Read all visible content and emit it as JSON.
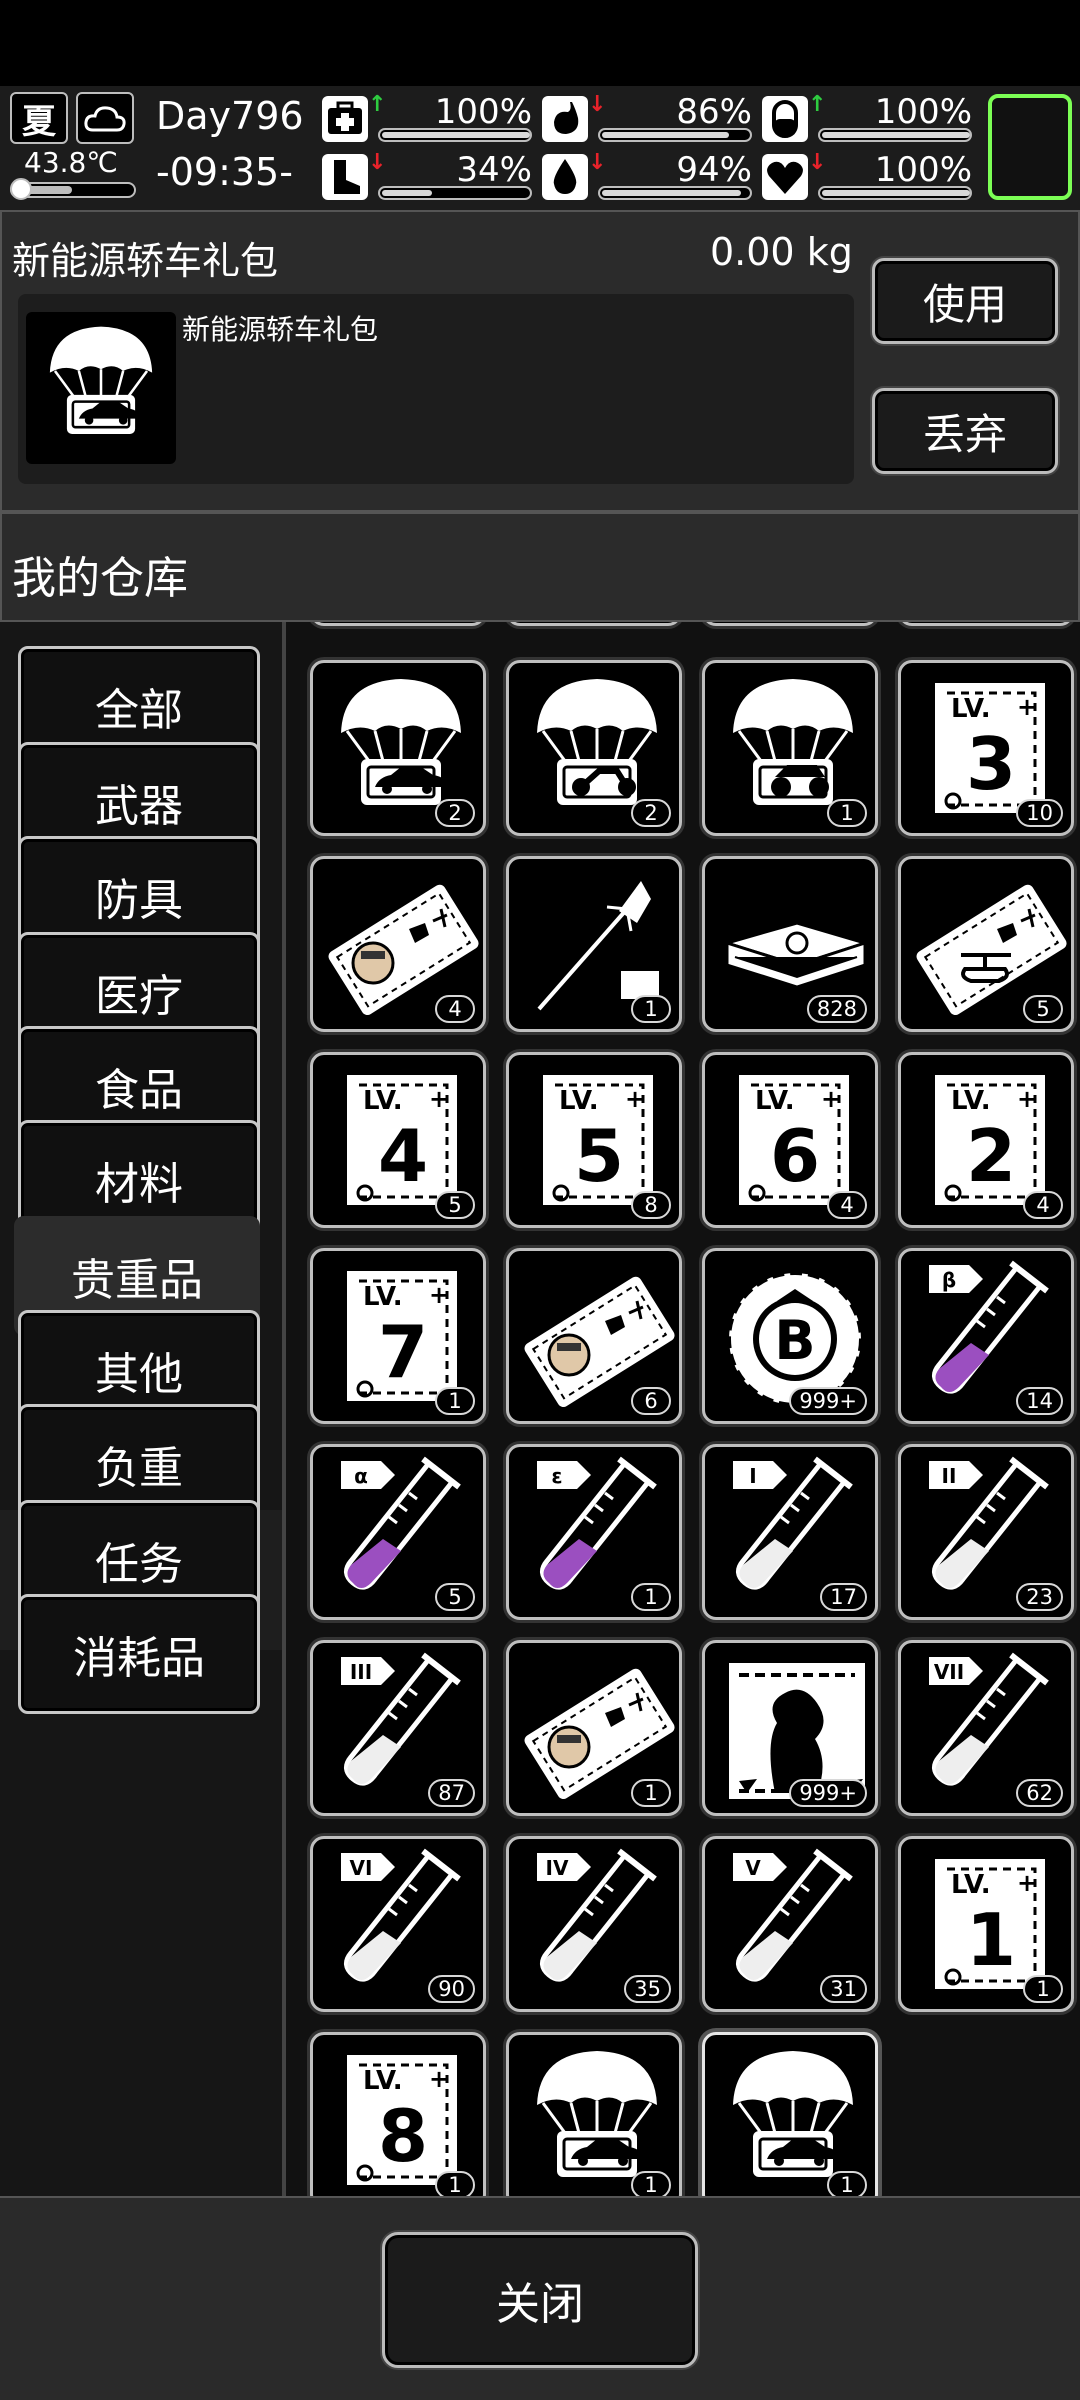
{
  "hud": {
    "season": "夏",
    "temperature": "43.8℃",
    "day": "Day796",
    "time": "-09:35-",
    "stats": [
      {
        "name": "health",
        "icon": "first-aid-icon",
        "trend": "up",
        "value": "100%",
        "level": 1.0
      },
      {
        "name": "hunger",
        "icon": "stomach-icon",
        "trend": "down",
        "value": "86%",
        "level": 0.86
      },
      {
        "name": "immunity",
        "icon": "pill-icon",
        "trend": "up",
        "value": "100%",
        "level": 1.0
      },
      {
        "name": "stamina",
        "icon": "boot-icon",
        "trend": "down",
        "value": "34%",
        "level": 0.34
      },
      {
        "name": "thirst",
        "icon": "water-drop-icon",
        "trend": "down",
        "value": "94%",
        "level": 0.94
      },
      {
        "name": "mood",
        "icon": "heart-icon",
        "trend": "down",
        "value": "100%",
        "level": 1.0
      }
    ],
    "colors": {
      "up": "#2ecc40",
      "down": "#e8222a",
      "slot_border": "#7cff55"
    }
  },
  "detail": {
    "name": "新能源轿车礼包",
    "weight": "0.00 kg",
    "description": "新能源轿车礼包",
    "icon": "parachute-car-crate-icon",
    "use_label": "使用",
    "drop_label": "丢弃"
  },
  "warehouse": {
    "title": "我的仓库",
    "categories": [
      "全部",
      "武器",
      "防具",
      "医疗",
      "食品",
      "材料",
      "贵重品",
      "其他",
      "负重",
      "任务",
      "消耗品"
    ],
    "active_category": "贵重品",
    "items": [
      {
        "icon": "parachute-car-icon",
        "count": "2"
      },
      {
        "icon": "parachute-motorcycle-icon",
        "count": "2"
      },
      {
        "icon": "parachute-atv-icon",
        "count": "1"
      },
      {
        "icon": "level-book-icon",
        "level": "3",
        "count": "10"
      },
      {
        "icon": "ticket-portrait-icon",
        "count": "4"
      },
      {
        "icon": "dart-icon",
        "count": "1"
      },
      {
        "icon": "cash-stack-icon",
        "count": "828"
      },
      {
        "icon": "ticket-helicopter-icon",
        "count": "5"
      },
      {
        "icon": "level-book-icon",
        "level": "4",
        "count": "5"
      },
      {
        "icon": "level-book-icon",
        "level": "5",
        "count": "8"
      },
      {
        "icon": "level-book-icon",
        "level": "6",
        "count": "4"
      },
      {
        "icon": "level-book-icon",
        "level": "2",
        "count": "4"
      },
      {
        "icon": "level-book-icon",
        "level": "7",
        "count": "1"
      },
      {
        "icon": "ticket-portrait-icon",
        "count": "6"
      },
      {
        "icon": "bitcoin-coin-icon",
        "symbol": "B",
        "count": "999+"
      },
      {
        "icon": "test-tube-icon",
        "tag": "β",
        "fill": "purple",
        "count": "14"
      },
      {
        "icon": "test-tube-icon",
        "tag": "α",
        "fill": "purple",
        "count": "5"
      },
      {
        "icon": "test-tube-icon",
        "tag": "ε",
        "fill": "purple",
        "count": "1"
      },
      {
        "icon": "test-tube-icon",
        "tag": "I",
        "fill": "white",
        "count": "17"
      },
      {
        "icon": "test-tube-icon",
        "tag": "II",
        "fill": "white",
        "count": "23"
      },
      {
        "icon": "test-tube-icon",
        "tag": "III",
        "fill": "white",
        "count": "87"
      },
      {
        "icon": "ticket-portrait-icon",
        "count": "1"
      },
      {
        "icon": "zombie-card-icon",
        "count": "999+"
      },
      {
        "icon": "test-tube-icon",
        "tag": "VII",
        "fill": "white",
        "count": "62"
      },
      {
        "icon": "test-tube-icon",
        "tag": "VI",
        "fill": "white",
        "count": "90"
      },
      {
        "icon": "test-tube-icon",
        "tag": "IV",
        "fill": "white",
        "count": "35"
      },
      {
        "icon": "test-tube-icon",
        "tag": "V",
        "fill": "white",
        "count": "31"
      },
      {
        "icon": "level-book-icon",
        "level": "1",
        "count": "1"
      },
      {
        "icon": "level-book-icon",
        "level": "8",
        "count": "1"
      },
      {
        "icon": "parachute-car-icon",
        "count": "1"
      },
      {
        "icon": "parachute-car-icon",
        "count": "1",
        "selected": true
      }
    ],
    "purple": "#9b4fc0"
  },
  "footer": {
    "close_label": "关闭"
  }
}
